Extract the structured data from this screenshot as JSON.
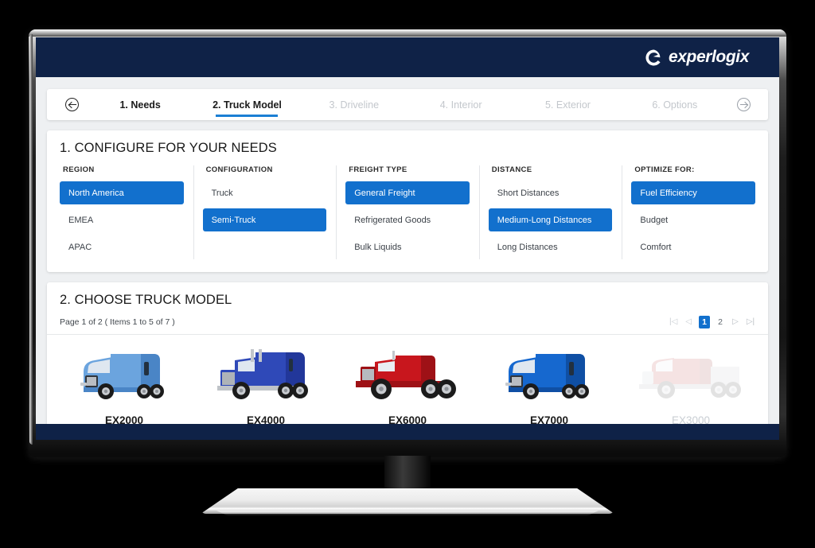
{
  "brand": {
    "name": "experlogix",
    "mark_icon": "experlogix-e-mark",
    "header_bg": "#0f2247"
  },
  "theme": {
    "accent_blue": "#1270cd",
    "navy": "#0f2247",
    "page_bg": "#eef0f2",
    "muted_text": "#c3c7cc"
  },
  "steps": {
    "prev_icon": "circle-arrow-left-icon",
    "next_icon": "circle-arrow-right-icon",
    "items": [
      {
        "label": "1. Needs",
        "state": "done"
      },
      {
        "label": "2. Truck Model",
        "state": "active"
      },
      {
        "label": "3. Driveline",
        "state": "upcoming"
      },
      {
        "label": "4. Interior",
        "state": "upcoming"
      },
      {
        "label": "5. Exterior",
        "state": "upcoming"
      },
      {
        "label": "6. Options",
        "state": "upcoming"
      }
    ]
  },
  "needs": {
    "title": "1. CONFIGURE FOR YOUR NEEDS",
    "columns": [
      {
        "header": "REGION",
        "options": [
          {
            "label": "North America",
            "selected": true
          },
          {
            "label": "EMEA",
            "selected": false
          },
          {
            "label": "APAC",
            "selected": false
          }
        ]
      },
      {
        "header": "CONFIGURATION",
        "options": [
          {
            "label": "Truck",
            "selected": false
          },
          {
            "label": "Semi-Truck",
            "selected": true
          },
          {
            "label": "",
            "selected": false
          }
        ]
      },
      {
        "header": "FREIGHT TYPE",
        "options": [
          {
            "label": "General Freight",
            "selected": true
          },
          {
            "label": "Refrigerated Goods",
            "selected": false
          },
          {
            "label": "Bulk Liquids",
            "selected": false
          }
        ]
      },
      {
        "header": "DISTANCE",
        "options": [
          {
            "label": "Short Distances",
            "selected": false
          },
          {
            "label": "Medium-Long Distances",
            "selected": true
          },
          {
            "label": "Long Distances",
            "selected": false
          }
        ]
      },
      {
        "header": "OPTIMIZE FOR:",
        "options": [
          {
            "label": "Fuel Efficiency",
            "selected": true
          },
          {
            "label": "Budget",
            "selected": false
          },
          {
            "label": "Comfort",
            "selected": false
          }
        ]
      }
    ]
  },
  "models": {
    "title": "2. CHOOSE TRUCK MODEL",
    "count_text": "Page 1 of 2 ( Items 1 to 5 of 7 )",
    "pager": {
      "first_icon": "page-first-icon",
      "prev_icon": "page-prev-icon",
      "next_icon": "page-next-icon",
      "last_icon": "page-last-icon",
      "pages": [
        {
          "label": "1",
          "current": true
        },
        {
          "label": "2",
          "current": false
        }
      ]
    },
    "items": [
      {
        "name": "EX2000",
        "icon": "truck-aero-daycab",
        "body": "#6ba4de",
        "body2": "#4a85c6",
        "disabled": false
      },
      {
        "name": "EX4000",
        "icon": "truck-classic-sleeper",
        "body": "#2f49b8",
        "body2": "#22379a",
        "disabled": false
      },
      {
        "name": "EX6000",
        "icon": "truck-heavy-vocational",
        "body": "#c8161d",
        "body2": "#9e1116",
        "disabled": false
      },
      {
        "name": "EX7000",
        "icon": "truck-aero-sleeper",
        "body": "#1668cf",
        "body2": "#0f4fa4",
        "disabled": false
      },
      {
        "name": "EX3000",
        "icon": "truck-red-daycab",
        "body": "#b31f26",
        "body2": "#8c171d",
        "disabled": true
      }
    ]
  }
}
